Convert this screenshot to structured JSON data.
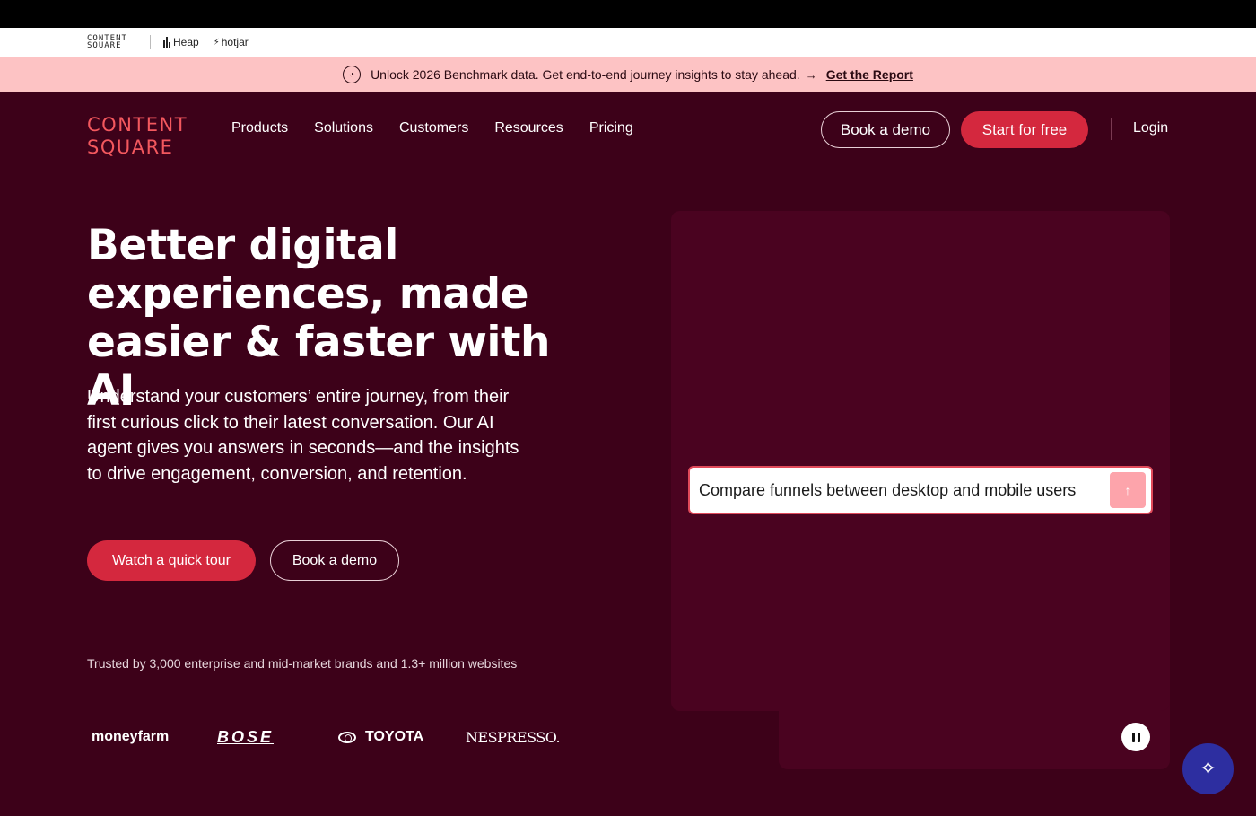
{
  "brandbar": {
    "contentsquare_line1": "CONTENT",
    "contentsquare_line2": "SQUARE",
    "heap": "Heap",
    "hotjar": "hotjar"
  },
  "promo": {
    "text": "Unlock 2026 Benchmark data. Get end-to-end journey insights to stay ahead.",
    "arrow": "→",
    "link": "Get the Report",
    "icon": "clock-icon"
  },
  "nav": {
    "logo_line1": "CONTENT",
    "logo_line2": "SQUARE",
    "links": [
      "Products",
      "Solutions",
      "Customers",
      "Resources",
      "Pricing"
    ],
    "book_demo": "Book a demo",
    "start_free": "Start for free",
    "login": "Login"
  },
  "hero": {
    "title": "Better digital experiences, made easier & faster with AI",
    "subtitle": "Understand your customers’ entire journey, from their first curious click to their latest conversation. Our AI agent gives you answers in seconds—and the insights to drive engagement, conversion, and retention.",
    "watch_tour": "Watch a quick tour",
    "book_demo": "Book a demo",
    "trusted": "Trusted by 3,000 enterprise and mid-market brands and 1.3+ million websites"
  },
  "customer_logos": {
    "moneyfarm": "moneyfarm",
    "bose": "BOSE",
    "toyota": "TOYOTA",
    "nespresso": "NESPRESSO."
  },
  "demo": {
    "prompt": "Compare funnels between desktop and mobile users",
    "send_icon": "arrow-up-icon",
    "pause_icon": "pause-icon",
    "assistant_icon": "sparkle-icon"
  },
  "colors": {
    "background": "#3d0119",
    "panel": "#4a0320",
    "accent": "#d4283e",
    "logo": "#f3585e",
    "promo_bg": "#fdc3c4",
    "assistant": "#2d2ea0"
  }
}
